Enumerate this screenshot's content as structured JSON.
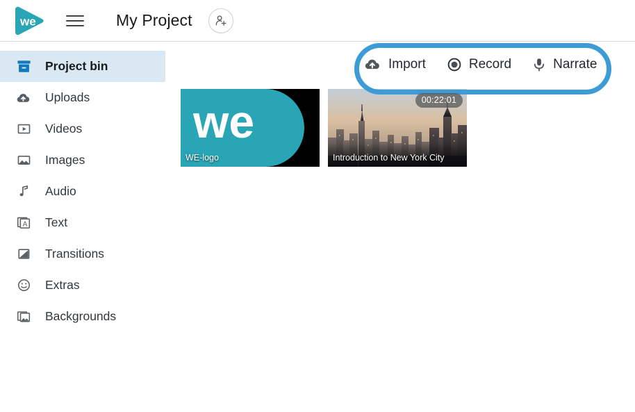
{
  "header": {
    "logo_icon": "we-play-logo",
    "logo_text": "we",
    "menu_icon": "hamburger-menu-icon",
    "project_title": "My Project",
    "invite_icon": "add-person-icon"
  },
  "sidebar": {
    "items": [
      {
        "label": "Project bin",
        "icon": "project-bin-icon",
        "active": true
      },
      {
        "label": "Uploads",
        "icon": "cloud-upload-icon",
        "active": false
      },
      {
        "label": "Videos",
        "icon": "video-play-icon",
        "active": false
      },
      {
        "label": "Images",
        "icon": "image-icon",
        "active": false
      },
      {
        "label": "Audio",
        "icon": "music-note-icon",
        "active": false
      },
      {
        "label": "Text",
        "icon": "text-box-icon",
        "active": false
      },
      {
        "label": "Transitions",
        "icon": "transition-icon",
        "active": false
      },
      {
        "label": "Extras",
        "icon": "smiley-face-icon",
        "active": false
      },
      {
        "label": "Backgrounds",
        "icon": "backgrounds-icon",
        "active": false
      }
    ]
  },
  "toolbar": {
    "import_label": "Import",
    "import_icon": "cloud-upload-icon",
    "record_label": "Record",
    "record_icon": "record-circle-icon",
    "narrate_label": "Narrate",
    "narrate_icon": "microphone-icon",
    "highlight_color": "#3d9bd6"
  },
  "media": {
    "tiles": [
      {
        "title": "WE-logo",
        "duration": "",
        "kind": "image"
      },
      {
        "title": "Introduction to New York City",
        "duration": "00:22:01",
        "kind": "video"
      }
    ]
  },
  "colors": {
    "brand_teal": "#2aa5b5",
    "accent_blue": "#1279bf",
    "selected_row": "#d9e8f3",
    "annotation_blue": "#3d9bd6"
  }
}
